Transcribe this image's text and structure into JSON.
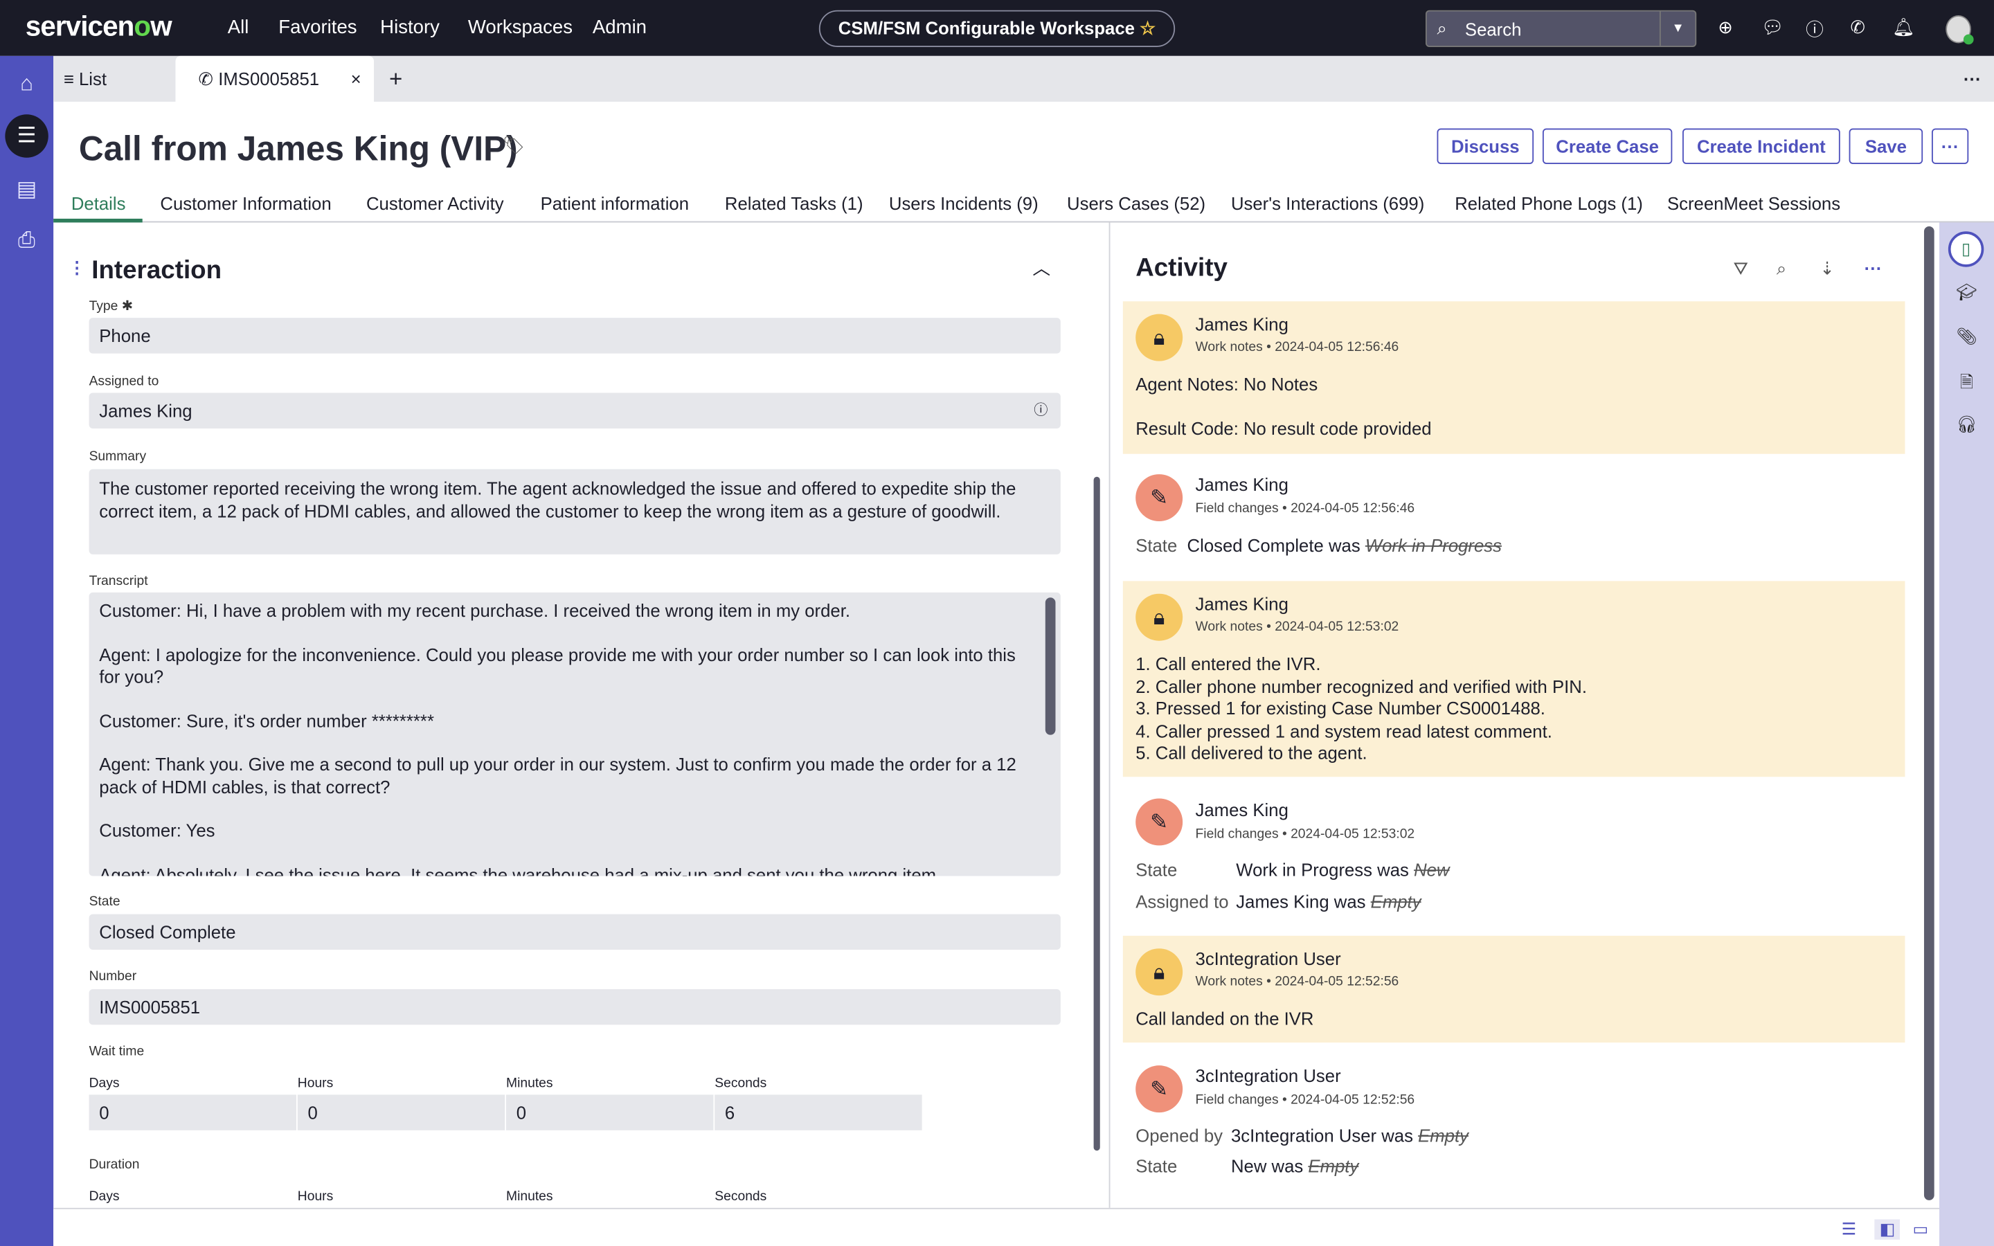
{
  "topbar": {
    "logo": "servicenow",
    "nav": [
      "All",
      "Favorites",
      "History",
      "Workspaces",
      "Admin"
    ],
    "workspace": "CSM/FSM Configurable Workspace",
    "search_placeholder": "Search",
    "icons": [
      "globe-icon",
      "chat-icon",
      "help-icon",
      "phone-icon",
      "bell-icon"
    ]
  },
  "rail": {
    "icons": [
      "home-icon",
      "list-icon",
      "dashboard-icon",
      "inbox-icon"
    ],
    "active": "list-icon"
  },
  "tabstrip": {
    "list_tab": "List",
    "record_tab": "IMS0005851"
  },
  "header": {
    "title": "Call from James King (VIP)",
    "buttons": [
      "Discuss",
      "Create Case",
      "Create Incident",
      "Save"
    ]
  },
  "record_tabs": [
    "Details",
    "Customer Information",
    "Customer Activity",
    "Patient information",
    "Related Tasks (1)",
    "Users Incidents (9)",
    "Users Cases (52)",
    "User's Interactions (699)",
    "Related Phone Logs (1)",
    "ScreenMeet Sessions"
  ],
  "active_tab": "Details",
  "form": {
    "section": "Interaction",
    "type": {
      "label": "Type",
      "required": "✱",
      "value": "Phone"
    },
    "assigned_to": {
      "label": "Assigned to",
      "value": "James King"
    },
    "summary": {
      "label": "Summary",
      "value": "The customer reported receiving the wrong item. The agent acknowledged the issue and offered to expedite ship the correct item, a 12 pack of HDMI cables, and allowed the customer to keep the wrong item as a gesture of goodwill."
    },
    "transcript": {
      "label": "Transcript",
      "lines": [
        "Customer: Hi, I have a problem with my recent purchase. I received the wrong item in my order.",
        "Agent: I apologize for the inconvenience. Could you please provide me with your order number so I can look into this for you?",
        "Customer: Sure, it's order number *********",
        "Agent: Thank you. Give me a second to pull up your order in our system. Just to confirm you made the order for a 12 pack of HDMI cables, is that correct?",
        "Customer: Yes",
        "Agent: Absolutely, I see the issue here. It seems the warehouse had a mix-up and sent you the wrong item."
      ]
    },
    "state": {
      "label": "State",
      "value": "Closed Complete"
    },
    "number": {
      "label": "Number",
      "value": "IMS0005851"
    },
    "wait_time": {
      "label": "Wait time",
      "units": [
        "Days",
        "Hours",
        "Minutes",
        "Seconds"
      ],
      "values": [
        "0",
        "0",
        "0",
        "6"
      ]
    },
    "duration": {
      "label": "Duration",
      "units": [
        "Days",
        "Hours",
        "Minutes",
        "Seconds"
      ]
    }
  },
  "activity": {
    "title": "Activity",
    "entries": [
      {
        "user": "James King",
        "kind": "Work notes",
        "time": "2024-04-05 12:56:46",
        "lines": [
          "Agent Notes: No Notes",
          "Result Code: No result code provided"
        ]
      },
      {
        "user": "James King",
        "kind": "Field changes",
        "time": "2024-04-05 12:56:46",
        "changes": [
          {
            "field": "State",
            "new": "Closed Complete was",
            "old": "Work in Progress"
          }
        ]
      },
      {
        "user": "James King",
        "kind": "Work notes",
        "time": "2024-04-05 12:53:02",
        "lines": [
          "1. Call entered the IVR.",
          "2. Caller phone number recognized and verified with PIN.",
          "3. Pressed 1 for existing Case Number CS0001488.",
          "4. Caller pressed 1 and system read latest comment.",
          "5. Call delivered to the agent."
        ]
      },
      {
        "user": "James King",
        "kind": "Field changes",
        "time": "2024-04-05 12:53:02",
        "changes": [
          {
            "field": "State",
            "new": "Work in Progress was",
            "old": "New"
          },
          {
            "field": "Assigned to",
            "new": "James King was",
            "old": "Empty"
          }
        ]
      },
      {
        "user": "3cIntegration User",
        "kind": "Work notes",
        "time": "2024-04-05 12:52:56",
        "lines": [
          "Call landed on the IVR"
        ]
      },
      {
        "user": "3cIntegration User",
        "kind": "Field changes",
        "time": "2024-04-05 12:52:56",
        "changes": [
          {
            "field": "Opened by",
            "new": "3cIntegration User was",
            "old": "Empty"
          },
          {
            "field": "State",
            "new": "New was",
            "old": "Empty"
          }
        ]
      }
    ]
  },
  "colors": {
    "topbar": "#1a1b27",
    "rail": "#4f52bd",
    "accent": "#4f52bd",
    "active_tab": "#2e7d5b",
    "work_note_bg": "#fcf0d4"
  }
}
